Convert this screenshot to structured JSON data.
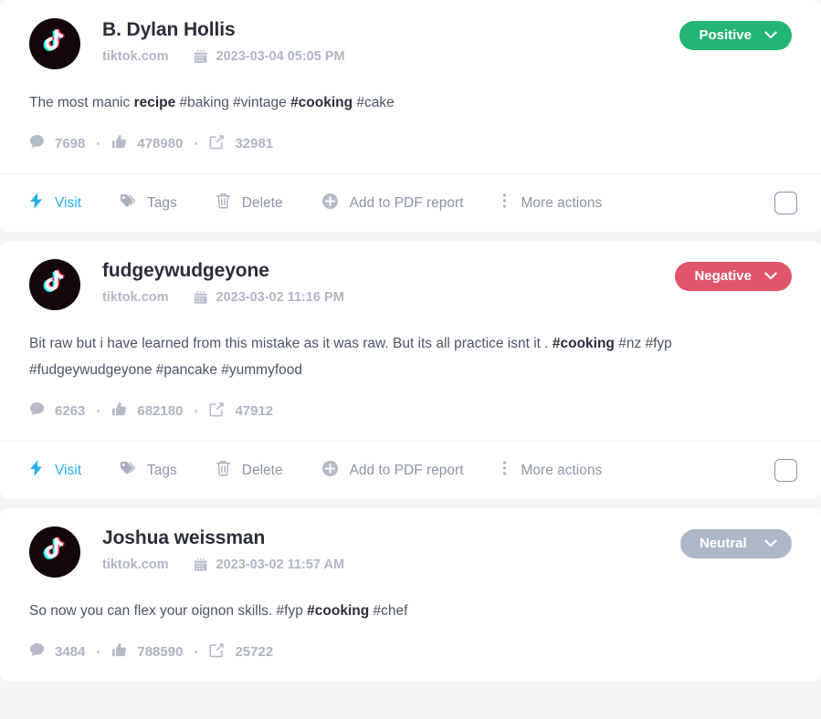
{
  "page": {
    "background_color": "#f4f5f7",
    "card_background": "#ffffff",
    "link_color": "#25b0f0"
  },
  "sentiment_colors": {
    "positive": "#22b573",
    "negative": "#e0556a",
    "neutral": "#aeb7c6"
  },
  "action_labels": {
    "visit": "Visit",
    "tags": "Tags",
    "delete": "Delete",
    "add_to_pdf": "Add to PDF report",
    "more": "More actions"
  },
  "posts": [
    {
      "author": "B. Dylan Hollis",
      "source": "tiktok.com",
      "date": "2023-03-04 05:05 PM",
      "sentiment": "Positive",
      "sentiment_class": "positive",
      "content_html": "The most manic <b>recipe</b> #baking #vintage <b>#cooking</b> #cake",
      "comments": "7698",
      "likes": "478980",
      "shares": "32981",
      "has_actions": true
    },
    {
      "author": "fudgeywudgeyone",
      "source": "tiktok.com",
      "date": "2023-03-02 11:16 PM",
      "sentiment": "Negative",
      "sentiment_class": "negative",
      "content_html": "Bit raw but i have learned from this mistake as it was raw. But its all practice isnt it . <b>#cooking</b> #nz #fyp #fudgeywudgeyone #pancake #yummyfood",
      "comments": "6263",
      "likes": "682180",
      "shares": "47912",
      "has_actions": true
    },
    {
      "author": "Joshua weissman",
      "source": "tiktok.com",
      "date": "2023-03-02 11:57 AM",
      "sentiment": "Neutral",
      "sentiment_class": "neutral",
      "content_html": "So now you can flex your oignon skills. #fyp <b>#cooking</b> #chef",
      "comments": "3484",
      "likes": "788590",
      "shares": "25722",
      "has_actions": false
    }
  ]
}
